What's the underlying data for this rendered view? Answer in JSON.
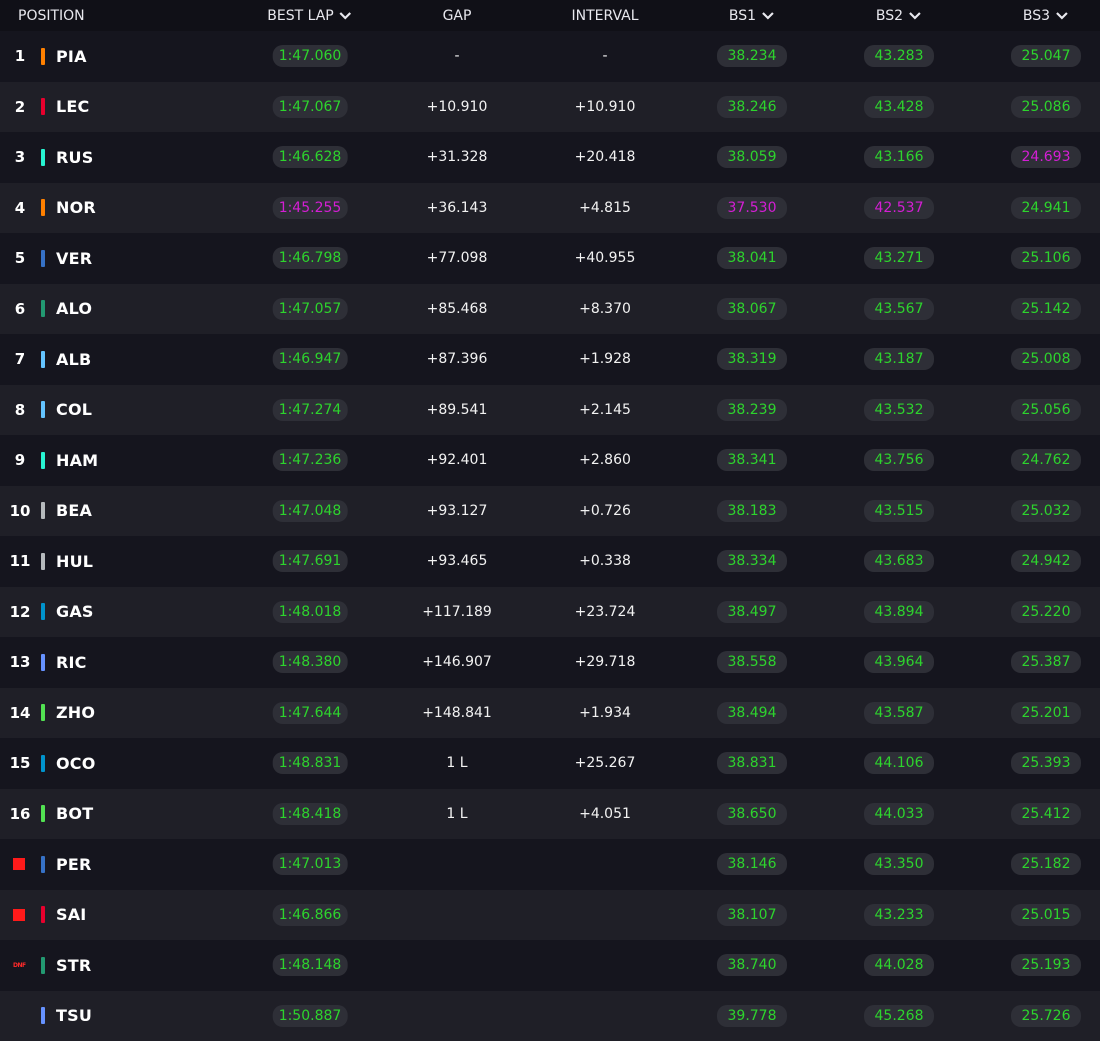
{
  "headers": {
    "position": "POSITION",
    "best_lap": "BEST LAP",
    "gap": "GAP",
    "interval": "INTERVAL",
    "bs1": "BS1",
    "bs2": "BS2",
    "bs3": "BS3"
  },
  "colors": {
    "green_time": "#2dd42d",
    "purple_time": "#d41ed4",
    "retired_flag": "#ff1a1a"
  },
  "rows": [
    {
      "pos": "1",
      "code": "PIA",
      "team_color": "#ff8000",
      "best_lap": "1:47.060",
      "best_lap_color": "green",
      "gap": "-",
      "interval": "-",
      "bs1": "38.234",
      "bs1_color": "green",
      "bs2": "43.283",
      "bs2_color": "green",
      "bs3": "25.047",
      "bs3_color": "green"
    },
    {
      "pos": "2",
      "code": "LEC",
      "team_color": "#e8002d",
      "best_lap": "1:47.067",
      "best_lap_color": "green",
      "gap": "+10.910",
      "interval": "+10.910",
      "bs1": "38.246",
      "bs1_color": "green",
      "bs2": "43.428",
      "bs2_color": "green",
      "bs3": "25.086",
      "bs3_color": "green"
    },
    {
      "pos": "3",
      "code": "RUS",
      "team_color": "#27f4d2",
      "best_lap": "1:46.628",
      "best_lap_color": "green",
      "gap": "+31.328",
      "interval": "+20.418",
      "bs1": "38.059",
      "bs1_color": "green",
      "bs2": "43.166",
      "bs2_color": "green",
      "bs3": "24.693",
      "bs3_color": "purple"
    },
    {
      "pos": "4",
      "code": "NOR",
      "team_color": "#ff8000",
      "best_lap": "1:45.255",
      "best_lap_color": "purple",
      "gap": "+36.143",
      "interval": "+4.815",
      "bs1": "37.530",
      "bs1_color": "purple",
      "bs2": "42.537",
      "bs2_color": "purple",
      "bs3": "24.941",
      "bs3_color": "green"
    },
    {
      "pos": "5",
      "code": "VER",
      "team_color": "#3671c6",
      "best_lap": "1:46.798",
      "best_lap_color": "green",
      "gap": "+77.098",
      "interval": "+40.955",
      "bs1": "38.041",
      "bs1_color": "green",
      "bs2": "43.271",
      "bs2_color": "green",
      "bs3": "25.106",
      "bs3_color": "green"
    },
    {
      "pos": "6",
      "code": "ALO",
      "team_color": "#229971",
      "best_lap": "1:47.057",
      "best_lap_color": "green",
      "gap": "+85.468",
      "interval": "+8.370",
      "bs1": "38.067",
      "bs1_color": "green",
      "bs2": "43.567",
      "bs2_color": "green",
      "bs3": "25.142",
      "bs3_color": "green"
    },
    {
      "pos": "7",
      "code": "ALB",
      "team_color": "#64c4ff",
      "best_lap": "1:46.947",
      "best_lap_color": "green",
      "gap": "+87.396",
      "interval": "+1.928",
      "bs1": "38.319",
      "bs1_color": "green",
      "bs2": "43.187",
      "bs2_color": "green",
      "bs3": "25.008",
      "bs3_color": "green"
    },
    {
      "pos": "8",
      "code": "COL",
      "team_color": "#64c4ff",
      "best_lap": "1:47.274",
      "best_lap_color": "green",
      "gap": "+89.541",
      "interval": "+2.145",
      "bs1": "38.239",
      "bs1_color": "green",
      "bs2": "43.532",
      "bs2_color": "green",
      "bs3": "25.056",
      "bs3_color": "green"
    },
    {
      "pos": "9",
      "code": "HAM",
      "team_color": "#27f4d2",
      "best_lap": "1:47.236",
      "best_lap_color": "green",
      "gap": "+92.401",
      "interval": "+2.860",
      "bs1": "38.341",
      "bs1_color": "green",
      "bs2": "43.756",
      "bs2_color": "green",
      "bs3": "24.762",
      "bs3_color": "green"
    },
    {
      "pos": "10",
      "code": "BEA",
      "team_color": "#b6babd",
      "best_lap": "1:47.048",
      "best_lap_color": "green",
      "gap": "+93.127",
      "interval": "+0.726",
      "bs1": "38.183",
      "bs1_color": "green",
      "bs2": "43.515",
      "bs2_color": "green",
      "bs3": "25.032",
      "bs3_color": "green"
    },
    {
      "pos": "11",
      "code": "HUL",
      "team_color": "#b6babd",
      "best_lap": "1:47.691",
      "best_lap_color": "green",
      "gap": "+93.465",
      "interval": "+0.338",
      "bs1": "38.334",
      "bs1_color": "green",
      "bs2": "43.683",
      "bs2_color": "green",
      "bs3": "24.942",
      "bs3_color": "green"
    },
    {
      "pos": "12",
      "code": "GAS",
      "team_color": "#0093cc",
      "best_lap": "1:48.018",
      "best_lap_color": "green",
      "gap": "+117.189",
      "interval": "+23.724",
      "bs1": "38.497",
      "bs1_color": "green",
      "bs2": "43.894",
      "bs2_color": "green",
      "bs3": "25.220",
      "bs3_color": "green"
    },
    {
      "pos": "13",
      "code": "RIC",
      "team_color": "#6692ff",
      "best_lap": "1:48.380",
      "best_lap_color": "green",
      "gap": "+146.907",
      "interval": "+29.718",
      "bs1": "38.558",
      "bs1_color": "green",
      "bs2": "43.964",
      "bs2_color": "green",
      "bs3": "25.387",
      "bs3_color": "green"
    },
    {
      "pos": "14",
      "code": "ZHO",
      "team_color": "#52e252",
      "best_lap": "1:47.644",
      "best_lap_color": "green",
      "gap": "+148.841",
      "interval": "+1.934",
      "bs1": "38.494",
      "bs1_color": "green",
      "bs2": "43.587",
      "bs2_color": "green",
      "bs3": "25.201",
      "bs3_color": "green"
    },
    {
      "pos": "15",
      "code": "OCO",
      "team_color": "#0093cc",
      "best_lap": "1:48.831",
      "best_lap_color": "green",
      "gap": "1 L",
      "interval": "+25.267",
      "bs1": "38.831",
      "bs1_color": "green",
      "bs2": "44.106",
      "bs2_color": "green",
      "bs3": "25.393",
      "bs3_color": "green"
    },
    {
      "pos": "16",
      "code": "BOT",
      "team_color": "#52e252",
      "best_lap": "1:48.418",
      "best_lap_color": "green",
      "gap": "1 L",
      "interval": "+4.051",
      "bs1": "38.650",
      "bs1_color": "green",
      "bs2": "44.033",
      "bs2_color": "green",
      "bs3": "25.412",
      "bs3_color": "green"
    },
    {
      "pos": "",
      "flag": "retired",
      "code": "PER",
      "team_color": "#3671c6",
      "best_lap": "1:47.013",
      "best_lap_color": "green",
      "gap": "",
      "interval": "",
      "bs1": "38.146",
      "bs1_color": "green",
      "bs2": "43.350",
      "bs2_color": "green",
      "bs3": "25.182",
      "bs3_color": "green"
    },
    {
      "pos": "",
      "flag": "retired",
      "code": "SAI",
      "team_color": "#e8002d",
      "best_lap": "1:46.866",
      "best_lap_color": "green",
      "gap": "",
      "interval": "",
      "bs1": "38.107",
      "bs1_color": "green",
      "bs2": "43.233",
      "bs2_color": "green",
      "bs3": "25.015",
      "bs3_color": "green"
    },
    {
      "pos": "",
      "flag": "dnf",
      "flag_text": "DNF",
      "code": "STR",
      "team_color": "#229971",
      "best_lap": "1:48.148",
      "best_lap_color": "green",
      "gap": "",
      "interval": "",
      "bs1": "38.740",
      "bs1_color": "green",
      "bs2": "44.028",
      "bs2_color": "green",
      "bs3": "25.193",
      "bs3_color": "green"
    },
    {
      "pos": "",
      "code": "TSU",
      "team_color": "#6692ff",
      "best_lap": "1:50.887",
      "best_lap_color": "green",
      "gap": "",
      "interval": "",
      "bs1": "39.778",
      "bs1_color": "green",
      "bs2": "45.268",
      "bs2_color": "green",
      "bs3": "25.726",
      "bs3_color": "green"
    }
  ]
}
